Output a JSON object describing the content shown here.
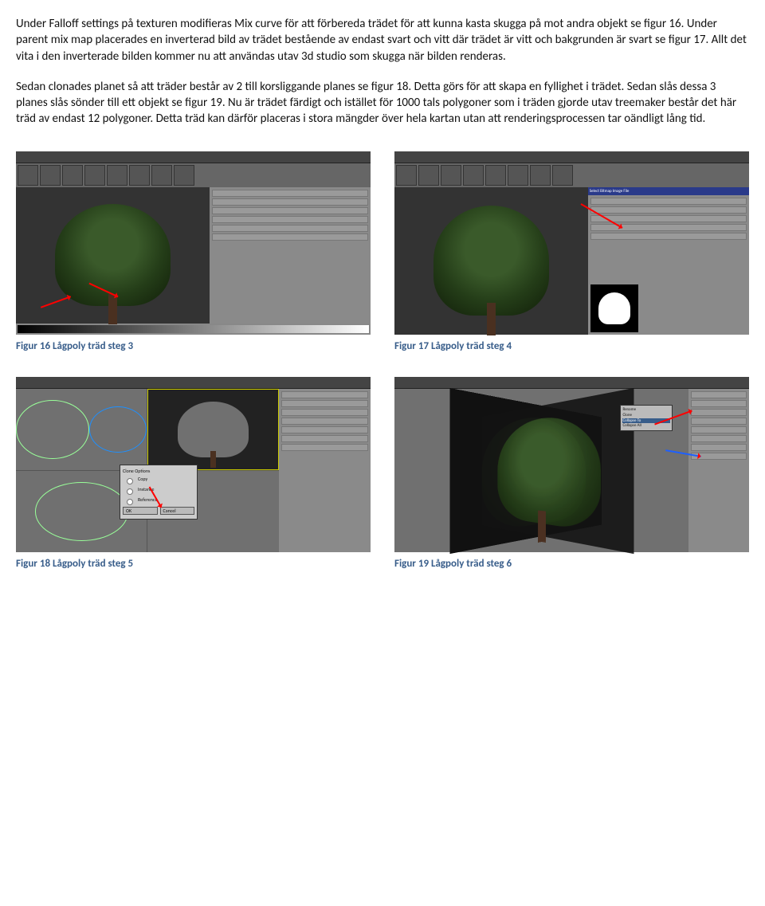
{
  "paragraphs": {
    "p1": "Under Falloff settings på texturen modifieras Mix curve för att förbereda trädet för att kunna kasta skugga på mot andra objekt se figur 16. Under parent mix map placerades en inverterad bild av trädet bestående av endast svart och vitt där trädet är vitt och bakgrunden är svart se figur 17. Allt det vita i den inverterade bilden kommer nu att användas utav 3d studio som skugga när bilden renderas.",
    "p2": "Sedan clonades planet så att träder består av 2 till korsliggande planes se figur 18. Detta görs för att skapa en fyllighet i trädet. Sedan slås dessa 3 planes slås sönder till ett objekt se figur 19. Nu är trädet färdigt och istället för 1000 tals polygoner som i träden gjorde utav treemaker består det här träd av endast 12 polygoner. Detta träd kan därför placeras i stora mängder över hela kartan utan att renderingsprocessen tar oändligt lång tid."
  },
  "captions": {
    "c16": "Figur 16 Lågpoly träd steg 3",
    "c17": "Figur 17 Lågpoly träd steg 4",
    "c18": "Figur 18 Lågpoly träd steg 5",
    "c19": "Figur 19 Lågpoly träd steg 6"
  }
}
